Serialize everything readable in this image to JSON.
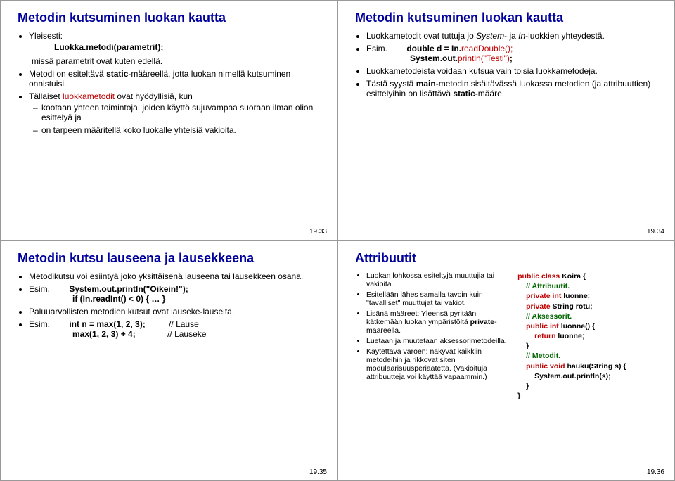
{
  "slide1": {
    "title": "Metodin kutsuminen luokan kautta",
    "b1": "Yleisesti:",
    "b1a": "Luokka.metodi(parametrit);",
    "b1b": "missä parametrit ovat kuten edellä.",
    "b2a": "Metodi on esiteltävä ",
    "b2b": "static",
    "b2c": "-määreellä, jotta luokan nimellä kutsuminen onnistuisi.",
    "b3a": "Tällaiset ",
    "b3b": "luokkametodit",
    "b3c": " ovat hyödyllisiä, kun",
    "b3s1": "kootaan yhteen toimintoja, joiden käyttö sujuvampaa suoraan ilman olion esittelyä ja",
    "b3s2": "on tarpeen määritellä koko luokalle yhteisiä vakioita.",
    "page": "19.33"
  },
  "slide2": {
    "title": "Metodin kutsuminen luokan kautta",
    "b1a": "Luokkametodit ovat tuttuja jo ",
    "b1b": "System",
    "b1c": "- ja ",
    "b1d": "In",
    "b1e": "-luokkien yhteydestä.",
    "b2": "Esim.",
    "b2c1": "double d = In.",
    "b2c2": "readDouble();",
    "b2c3": "System.out.",
    "b2c4": "println(\"Testi\")",
    "b2c5": ";",
    "b3": "Luokkametodeista voidaan kutsua vain toisia luokkametodeja.",
    "b4a": "Tästä syystä ",
    "b4b": "main",
    "b4c": "-metodin sisältävässä luokassa metodien (ja attribuuttien) esittelyihin on lisättävä ",
    "b4d": "static",
    "b4e": "-määre.",
    "page": "19.34"
  },
  "slide3": {
    "title": "Metodin kutsu lauseena ja lausekkeena",
    "b1": "Metodikutsu voi esiintyä joko yksittäisenä lauseena tai lausekkeen osana.",
    "b2": "Esim.",
    "b2c1": "System.out.println(\"Oikein!\");",
    "b2c2a": "if",
    "b2c2b": " (In.readInt() < 0) { … }",
    "b3": "Paluuarvollisten metodien kutsut ovat lauseke-lauseita.",
    "b4": "Esim.",
    "b4c1a": "int",
    "b4c1b": " n = max(1, 2, 3);",
    "b4c1c": "// Lause",
    "b4c2a": "max(1, 2, 3) + 4;",
    "b4c2b": "// Lauseke",
    "page": "19.35"
  },
  "slide4": {
    "title": "Attribuutit",
    "left": {
      "l1": "Luokan lohkossa esiteltyjä muuttujia tai vakioita.",
      "l2": "Esitellään lähes samalla tavoin kuin \"tavalliset\" muuttujat tai vakiot.",
      "l3a": "Lisänä määreet: Yleensä pyritään kätkemään luokan ympäristöltä ",
      "l3b": "private",
      "l3c": "-määreellä.",
      "l4": "Luetaan ja muutetaan aksessorimetodeilla.",
      "l5": "Käytettävä varoen: näkyvät kaikkiin metodeihin ja rikkovat siten modulaarisuusperiaatetta. (Vakioituja attribuutteja voi käyttää vapaammin.)"
    },
    "right": {
      "r1a": "public class",
      "r1b": " Koira {",
      "r2": "// Attribuutit.",
      "r3a": "private int",
      "r3b": " luonne;",
      "r4a": "private",
      "r4b": " String rotu;",
      "r5": "// Aksessorit.",
      "r6a": "public int",
      "r6b": " luonne() {",
      "r7a": "return",
      "r7b": " luonne;",
      "r8": "}",
      "r9": "// Metodit.",
      "r10a": "public void",
      "r10b": " hauku(String s) {",
      "r11": "System.out.println(s);",
      "r12": "}",
      "r13": "}"
    },
    "page": "19.36"
  }
}
